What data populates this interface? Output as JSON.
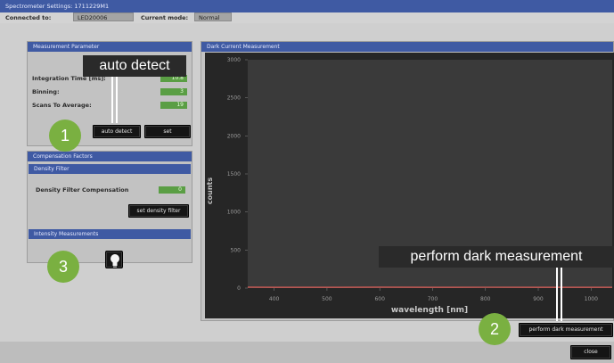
{
  "window": {
    "title": "Spectrometer Settings: 1711229M1"
  },
  "status": {
    "connected_label": "Connected to:",
    "connected_value": "LED20006",
    "mode_label": "Current mode:",
    "mode_value": "Normal"
  },
  "measurement_parameter": {
    "header": "Measurement Parameter",
    "rows": [
      {
        "label": "Integration Time [ms]:",
        "value": "10.8"
      },
      {
        "label": "Binning:",
        "value": "3"
      },
      {
        "label": "Scans To Average:",
        "value": "19"
      }
    ],
    "auto_detect_label": "auto detect",
    "set_label": "set"
  },
  "compensation": {
    "header": "Compensation Factors",
    "density_filter_header": "Density Filter",
    "density_label": "Density Filter Compensation",
    "density_value": "0",
    "set_density_label": "set density filter",
    "intensity_header": "Intensity Measurements"
  },
  "dark_current": {
    "header": "Dark Current Measurement",
    "perform_label": "perform dark measurement"
  },
  "footer": {
    "close_label": "close"
  },
  "callouts": [
    {
      "text": "auto detect"
    },
    {
      "text": "perform dark measurement"
    }
  ],
  "badges": [
    "1",
    "2",
    "3"
  ],
  "chart_data": {
    "type": "line",
    "xlabel": "wavelength [nm]",
    "ylabel": "counts",
    "xlim": [
      350,
      1040
    ],
    "ylim": [
      0,
      3000
    ],
    "xticks": [
      400,
      500,
      600,
      700,
      800,
      900,
      1000
    ],
    "yticks": [
      0,
      500,
      1000,
      1500,
      2000,
      2500,
      3000
    ],
    "grid": false,
    "series": [
      {
        "color": "#e0605a",
        "x": [
          350,
          400,
          500,
          600,
          700,
          800,
          900,
          1000,
          1040
        ],
        "y": [
          12,
          10,
          10,
          12,
          10,
          11,
          10,
          10,
          10
        ]
      }
    ]
  }
}
